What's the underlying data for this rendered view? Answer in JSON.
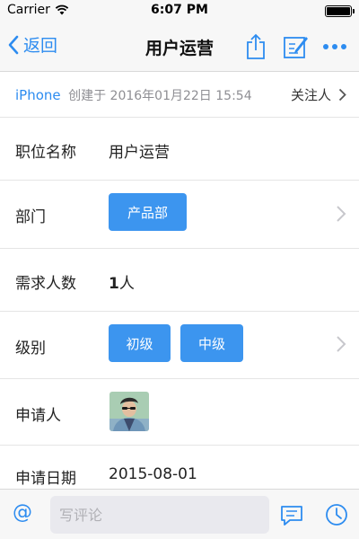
{
  "status_bar": {
    "carrier": "Carrier",
    "time": "6:07 PM"
  },
  "nav": {
    "back_label": "返回",
    "title": "用户运营",
    "icons": [
      "share-icon",
      "compose-icon",
      "more-icon"
    ]
  },
  "info": {
    "device": "iPhone",
    "created_text": "创建于 2016年01月22日 15:54",
    "followers_label": "关注人"
  },
  "fields": {
    "position": {
      "label": "职位名称",
      "value": "用户运营"
    },
    "department": {
      "label": "部门",
      "tag": "产品部"
    },
    "headcount": {
      "label": "需求人数",
      "number": "1",
      "unit": "人"
    },
    "level": {
      "label": "级别",
      "tags": [
        "初级",
        "中级"
      ]
    },
    "applicant": {
      "label": "申请人"
    },
    "apply_date": {
      "label": "申请日期",
      "value": "2015-08-01"
    }
  },
  "bottom": {
    "at_symbol": "@",
    "comment_placeholder": "写评论",
    "icons": [
      "comments-icon",
      "clock-icon"
    ]
  },
  "colors": {
    "accent": "#2d8cf0",
    "tag_background": "#3c95ef",
    "meta_text": "#8e8e93"
  }
}
